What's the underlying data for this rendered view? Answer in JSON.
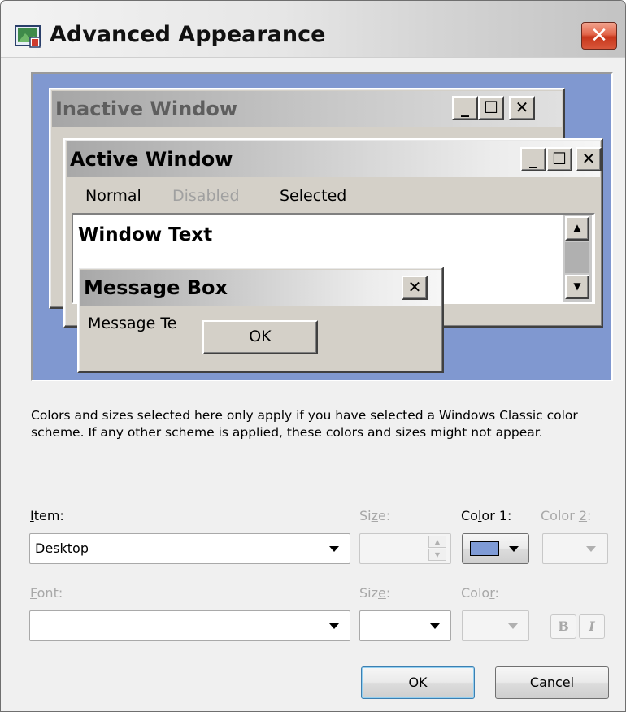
{
  "dialog": {
    "title": "Advanced Appearance",
    "close_glyph": "✕",
    "icon": "display-properties-icon"
  },
  "preview": {
    "inactive_title": "Inactive Window",
    "active_title": "Active Window",
    "menu": {
      "normal": "Normal",
      "disabled": "Disabled",
      "selected": "Selected"
    },
    "window_text": "Window Text",
    "message_box_title": "Message Box",
    "message_text": "Message Te",
    "ok_label": "OK",
    "caption_buttons": {
      "minimize": "_",
      "maximize": "☐",
      "close": "✕"
    },
    "desktop_color": "#8098d0"
  },
  "description": "Colors and sizes selected here only apply if you have selected a Windows Classic color scheme. If any other scheme is applied, these colors and sizes might not appear.",
  "labels": {
    "item_key": "I",
    "item_rest": "tem:",
    "size1_pre": "Si",
    "size1_key": "z",
    "size1_post": "e:",
    "color1_pre": "Co",
    "color1_key": "l",
    "color1_post": "or 1:",
    "color2_pre": "Color ",
    "color2_key": "2",
    "color2_post": ":",
    "font_key": "F",
    "font_rest": "ont:",
    "size2_pre": "Siz",
    "size2_key": "e",
    "size2_post": ":",
    "color3_pre": "Colo",
    "color3_key": "r",
    "color3_post": ":"
  },
  "controls": {
    "item_value": "Desktop",
    "color1_swatch": "#7f9bd6",
    "bold_label": "B",
    "italic_label": "I"
  },
  "buttons": {
    "ok": "OK",
    "cancel": "Cancel"
  }
}
